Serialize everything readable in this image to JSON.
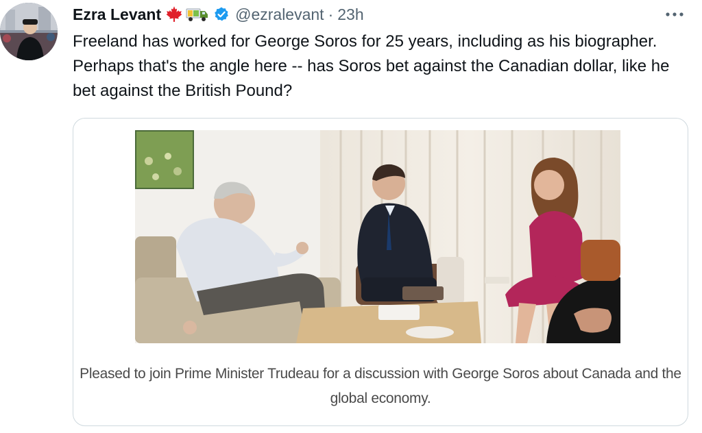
{
  "author": {
    "name": "Ezra Levant",
    "flag_emoji": "maple-leaf-icon",
    "truck_emoji": "truck-icon",
    "verified_icon": "verified-badge-icon",
    "handle": "@ezralevant",
    "separator": "·",
    "time": "23h"
  },
  "more_icon": "more-horizontal-icon",
  "tweet": {
    "text": "Freeland has worked for George Soros for 25 years, including as his biographer. Perhaps that's the angle here -- has Soros bet against the Canadian dollar, like he bet against the British Pound?"
  },
  "card": {
    "caption_line1": "Pleased to join Prime Minister Trudeau for a discussion with George Soros about Canada and the",
    "caption_line2": "global economy."
  },
  "colors": {
    "text": "#0f1419",
    "secondary": "#536471",
    "verified": "#1d9bf0",
    "border": "#cfd9de",
    "maple": "#e0202a"
  }
}
